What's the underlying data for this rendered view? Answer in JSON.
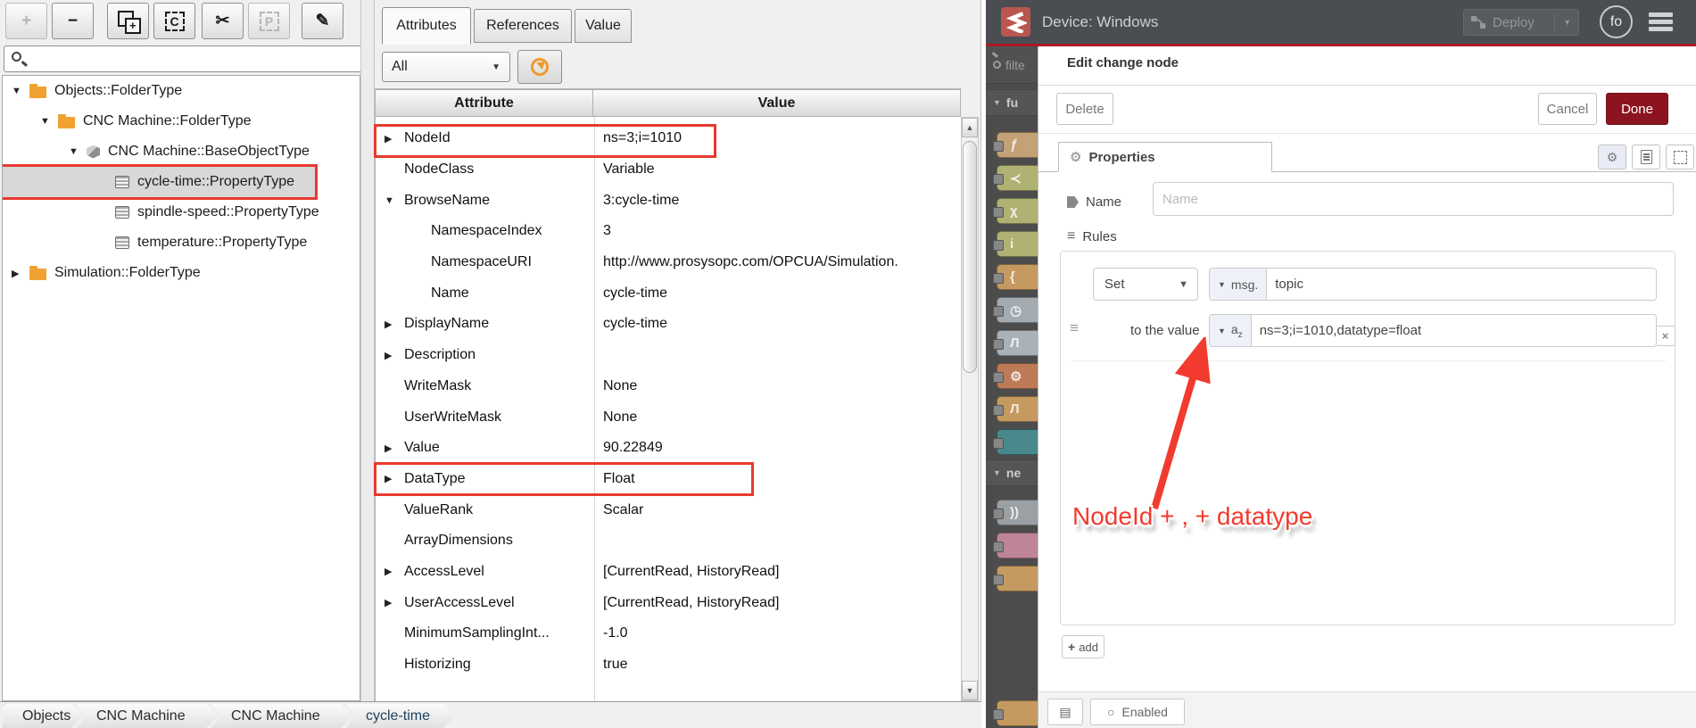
{
  "colors": {
    "annotation_red": "#e8392f",
    "selection_gray": "#d8d8d8",
    "folder_orange": "#f0a230",
    "nodered_red": "#ad1625",
    "done_red": "#8c1420",
    "header_gray": "#4a4e52"
  },
  "left_app": {
    "toolbar": {
      "buttons": [
        {
          "name": "add",
          "glyph": "+",
          "disabled": true
        },
        {
          "name": "remove",
          "glyph": "−",
          "disabled": false
        },
        {
          "name": "duplicate",
          "glyph": "+",
          "disabled": false
        },
        {
          "name": "copy",
          "glyph": "C",
          "disabled": false
        },
        {
          "name": "cut",
          "glyph": "✂",
          "disabled": false
        },
        {
          "name": "paste",
          "glyph": "P",
          "disabled": true
        },
        {
          "name": "edit",
          "glyph": "✎",
          "disabled": false
        }
      ]
    },
    "tree": {
      "items": [
        {
          "label": "Objects::FolderType",
          "icon": "folder",
          "expander": "down"
        },
        {
          "label": "CNC Machine::FolderType",
          "icon": "folder",
          "expander": "down"
        },
        {
          "label": "CNC Machine::BaseObjectType",
          "icon": "cube",
          "expander": "down"
        },
        {
          "label": "cycle-time::PropertyType",
          "icon": "property",
          "expander": "",
          "selected": true,
          "annotated": true
        },
        {
          "label": "spindle-speed::PropertyType",
          "icon": "property",
          "expander": ""
        },
        {
          "label": "temperature::PropertyType",
          "icon": "property",
          "expander": ""
        },
        {
          "label": "Simulation::FolderType",
          "icon": "folder",
          "expander": "right"
        }
      ]
    },
    "tabs": {
      "attributes": "Attributes",
      "references": "References",
      "value": "Value",
      "active": "Attributes"
    },
    "filter": {
      "selected": "All"
    },
    "table": {
      "columns": {
        "attr": "Attribute",
        "value": "Value"
      },
      "rows": [
        {
          "attr": "NodeId",
          "value": "ns=3;i=1010",
          "highlighted": true
        },
        {
          "attr": "NodeClass",
          "value": "Variable"
        },
        {
          "attr": "BrowseName",
          "value": "3:cycle-time"
        },
        {
          "attr": "NamespaceIndex",
          "value": "3"
        },
        {
          "attr": "NamespaceURI",
          "value": "http://www.prosysopc.com/OPCUA/Simulation."
        },
        {
          "attr": "Name",
          "value": "cycle-time"
        },
        {
          "attr": "DisplayName",
          "value": "cycle-time"
        },
        {
          "attr": "Description",
          "value": ""
        },
        {
          "attr": "WriteMask",
          "value": "None"
        },
        {
          "attr": "UserWriteMask",
          "value": "None"
        },
        {
          "attr": "Value",
          "value": "90.22849"
        },
        {
          "attr": "DataType",
          "value": "Float",
          "highlighted": true
        },
        {
          "attr": "ValueRank",
          "value": "Scalar"
        },
        {
          "attr": "ArrayDimensions",
          "value": ""
        },
        {
          "attr": "AccessLevel",
          "value": "[CurrentRead, HistoryRead]"
        },
        {
          "attr": "UserAccessLevel",
          "value": "[CurrentRead, HistoryRead]"
        },
        {
          "attr": "MinimumSamplingInt...",
          "value": "-1.0"
        },
        {
          "attr": "Historizing",
          "value": "true"
        }
      ]
    },
    "bottom_tabs": [
      "Objects",
      "CNC Machine",
      "CNC Machine",
      "cycle-time"
    ]
  },
  "node_red": {
    "header": {
      "title": "Device: Windows",
      "deploy_label": "Deploy",
      "user_badge": "fo"
    },
    "palette": {
      "search_text": "filte",
      "categories": {
        "function": "fu",
        "network": "ne"
      },
      "items": [
        {
          "glyph": "ƒ",
          "color": "#c2a276"
        },
        {
          "glyph": "≺",
          "color": "#b0b273"
        },
        {
          "glyph": "χ",
          "color": "#b0b273"
        },
        {
          "glyph": "i",
          "color": "#b0b273"
        },
        {
          "glyph": "{",
          "color": "#c59a60"
        },
        {
          "glyph": "◷",
          "color": "#a3abb1"
        },
        {
          "glyph": "Л",
          "color": "#aab2b8"
        },
        {
          "glyph": "⚙",
          "color": "#bd7a57"
        },
        {
          "glyph": "Л",
          "color": "#c59a60"
        },
        {
          "glyph": "",
          "color": "#49898b"
        },
        {
          "glyph": "))",
          "color": "#9aa0a4"
        },
        {
          "glyph": "",
          "color": "#bd8498"
        },
        {
          "glyph": "",
          "color": "#c59a60"
        },
        {
          "glyph": "",
          "color": "#c59a60"
        }
      ]
    },
    "dialog": {
      "title": "Edit change node",
      "delete_label": "Delete",
      "cancel_label": "Cancel",
      "done_label": "Done",
      "tab_label": "Properties",
      "name_label": "Name",
      "name_placeholder": "Name",
      "rules_label": "Rules",
      "rule": {
        "action": "Set",
        "target_prefix": "msg.",
        "target_value": "topic",
        "to_label": "to the value",
        "value_type": "az",
        "value": "ns=3;i=1010,datatype=float"
      },
      "add_label": "add",
      "enabled_label": "Enabled"
    },
    "annotation": {
      "text": "NodeId + , + datatype"
    }
  }
}
